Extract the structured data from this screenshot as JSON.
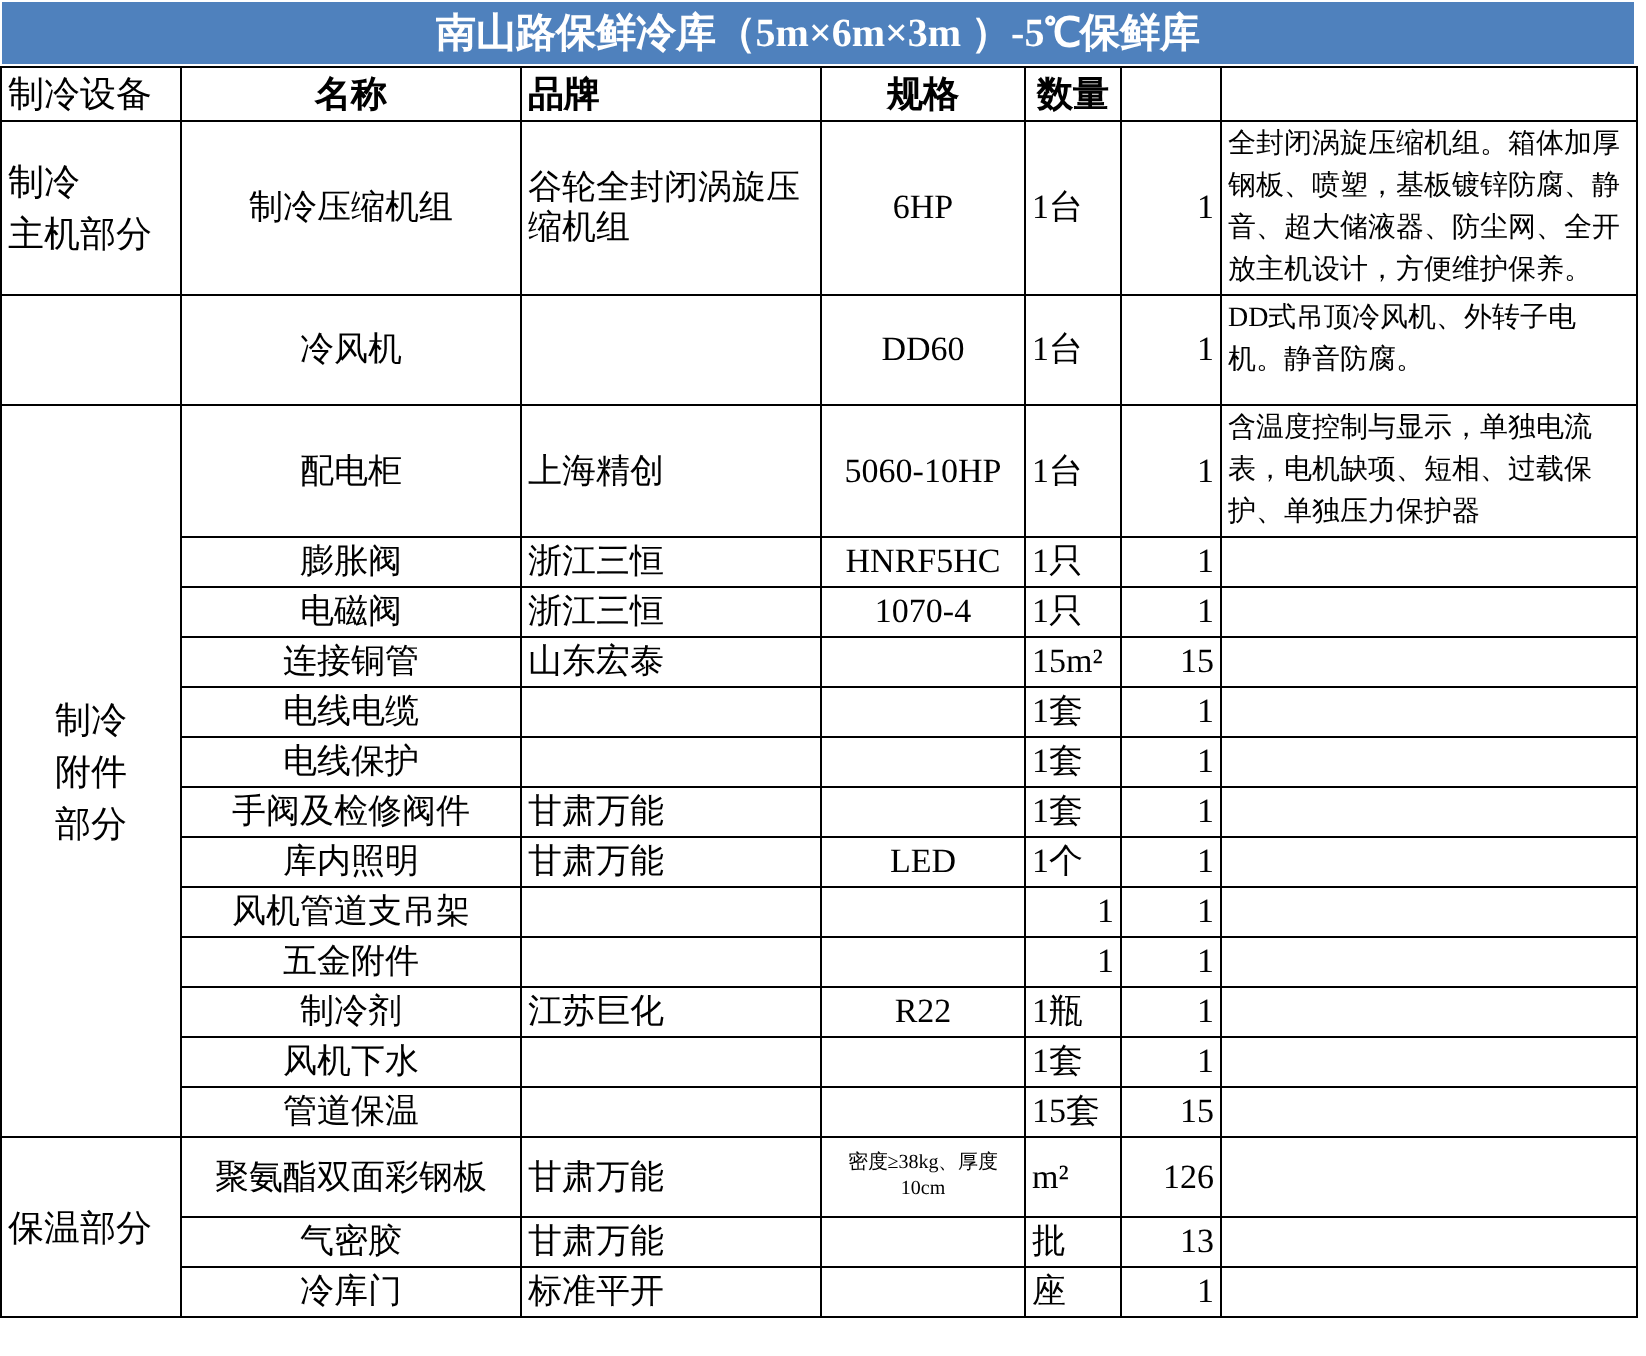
{
  "title": "南山路保鲜冷库（5m×6m×3m ）-5℃保鲜库",
  "columns": [
    "制冷设备",
    "名称",
    "品牌",
    "规格",
    "数量"
  ],
  "groups": [
    {
      "label": [
        "制冷",
        "主机部分"
      ],
      "rows": [
        {
          "name": "制冷压缩机组",
          "brand": "谷轮全封闭涡旋压缩机组",
          "spec": "6HP",
          "unit": "1台",
          "quantity": "1",
          "note": "全封闭涡旋压缩机组。箱体加厚钢板、喷塑，基板镀锌防腐、静音、超大储液器、防尘网、全开放主机设计，方便维护保养。"
        }
      ]
    },
    {
      "rows": [
        {
          "name": "冷风机",
          "spec": "DD60",
          "unit": "1台",
          "quantity": "1",
          "note": "DD式吊顶冷风机、外转子电机。静音防腐。"
        }
      ]
    },
    {
      "label": [
        "制冷",
        "附件",
        "部分"
      ],
      "rows": [
        {
          "name": "配电柜",
          "brand": "上海精创",
          "spec": "5060-10HP",
          "unit": "1台",
          "quantity": "1",
          "note": "含温度控制与显示，单独电流表，电机缺项、短相、过载保护、单独压力保护器"
        },
        {
          "name": "膨胀阀",
          "brand": "浙江三恒",
          "spec": "HNRF5HC",
          "unit": "1只",
          "quantity": "1"
        },
        {
          "name": "电磁阀",
          "brand": "浙江三恒",
          "spec": "1070-4",
          "unit": "1只",
          "quantity": "1"
        },
        {
          "name": "连接铜管",
          "brand": "山东宏泰",
          "unit": "15m²",
          "quantity": "15"
        },
        {
          "name": "电线电缆",
          "unit": "1套",
          "quantity": "1"
        },
        {
          "name": "电线保护",
          "unit": "1套",
          "quantity": "1"
        },
        {
          "name": "手阀及检修阀件",
          "brand": "甘肃万能",
          "unit": "1套",
          "quantity": "1"
        },
        {
          "name": "库内照明",
          "brand": "甘肃万能",
          "spec": "LED",
          "unit": "1个",
          "quantity": "1"
        },
        {
          "name": "风机管道支吊架",
          "unit": "1",
          "quantity": "1"
        },
        {
          "name": "五金附件",
          "unit": "1",
          "quantity": "1"
        },
        {
          "name": "制冷剂",
          "brand": "江苏巨化",
          "spec": "R22",
          "unit": "1瓶",
          "quantity": "1"
        },
        {
          "name": "风机下水",
          "unit": "1套",
          "quantity": "1"
        },
        {
          "name": "管道保温",
          "unit": "15套",
          "quantity": "15"
        }
      ]
    },
    {
      "label": [
        "保温部分"
      ],
      "rows": [
        {
          "name": "聚氨酯双面彩钢板",
          "brand": "甘肃万能",
          "spec": "密度≥38kg、厚度10cm",
          "unit": "m²",
          "quantity": "126"
        },
        {
          "name": "气密胶",
          "brand": "甘肃万能",
          "unit": "批",
          "quantity": "13"
        },
        {
          "name": "冷库门",
          "brand": "标准平开",
          "unit": "座",
          "quantity": "1"
        }
      ]
    }
  ]
}
